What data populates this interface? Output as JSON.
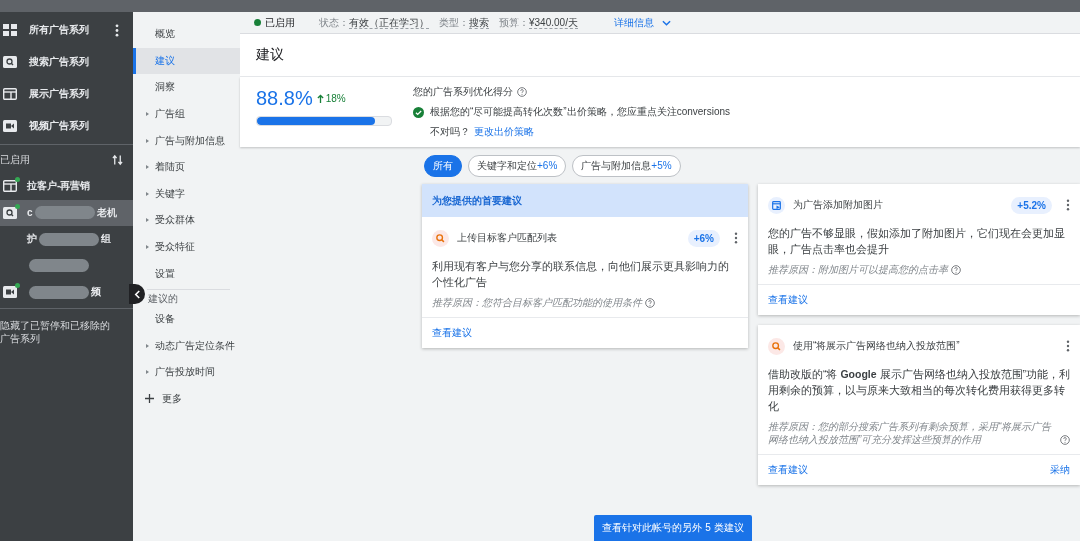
{
  "sidebar": {
    "header": {
      "label": "所有广告系列"
    },
    "types": [
      {
        "label": "搜索广告系列",
        "kind": "search"
      },
      {
        "label": "展示广告系列",
        "kind": "display"
      },
      {
        "label": "视频广告系列",
        "kind": "video"
      }
    ],
    "enabled_label": "已启用",
    "campaigns": [
      {
        "kind": "display",
        "prefix": "拉客户-再营销",
        "enabled": true,
        "selected": false
      },
      {
        "kind": "search",
        "prefix": "c",
        "suffix": "老机",
        "redacted": true,
        "enabled": true,
        "selected": true
      },
      {
        "kind": "adgroup",
        "prefix": "护",
        "suffix": "组",
        "redacted": true,
        "selected": false
      },
      {
        "kind": "adgroup",
        "redacted": true,
        "selected": false
      },
      {
        "kind": "video",
        "suffix": "频",
        "redacted": true,
        "enabled": true,
        "selected": false
      }
    ],
    "footer": "隐藏了已暂停和已移除的广告系列"
  },
  "nav": {
    "items": [
      {
        "label": "概览",
        "expandable": false,
        "selected": false
      },
      {
        "label": "建议",
        "expandable": false,
        "selected": true
      },
      {
        "label": "洞察",
        "expandable": false,
        "selected": false
      },
      {
        "label": "广告组",
        "expandable": true,
        "selected": false
      },
      {
        "label": "广告与附加信息",
        "expandable": true,
        "selected": false
      },
      {
        "label": "着陆页",
        "expandable": true,
        "selected": false
      },
      {
        "label": "关键字",
        "expandable": true,
        "selected": false
      },
      {
        "label": "受众群体",
        "expandable": true,
        "selected": false
      },
      {
        "label": "受众特征",
        "expandable": true,
        "selected": false
      },
      {
        "label": "设置",
        "expandable": false,
        "selected": false
      }
    ],
    "section_label": "建议的",
    "more_items": [
      {
        "label": "设备",
        "expandable": false,
        "selected": false
      },
      {
        "label": "动态广告定位条件",
        "expandable": true,
        "selected": false
      },
      {
        "label": "广告投放时间",
        "expandable": true,
        "selected": false
      }
    ],
    "more": "更多"
  },
  "status_bar": {
    "status": "已启用",
    "fields": [
      {
        "label": "状态：",
        "value": "有效（正在学习）"
      },
      {
        "label": "类型：",
        "value": "搜索"
      },
      {
        "label": "预算：",
        "value": "¥340.00/天"
      }
    ],
    "details": "详细信息"
  },
  "page_title": "建议",
  "score": {
    "value": "88.8%",
    "change": "18%",
    "level": 0.88,
    "title": "您的广告系列优化得分",
    "message": "根据您的“尽可能提高转化次数”出价策略，您应重点关注conversions",
    "question": "不对吗？",
    "link": "更改出价策略"
  },
  "chips": [
    {
      "label": "所有",
      "selected": true
    },
    {
      "label": "关键字和定位",
      "uplift": "+6%",
      "selected": false
    },
    {
      "label": "广告与附加信息",
      "uplift": "+5%",
      "selected": false
    }
  ],
  "columns": [
    {
      "header": "为您提供的首要建议",
      "cards": [
        {
          "kind": "search",
          "title": "上传目标客户匹配列表",
          "uplift": "+6%",
          "body": "利用现有客户与您分享的联系信息，向他们展示更具影响力的个性化广告",
          "reason": "推荐原因：您符合目标客户匹配功能的使用条件",
          "view": "查看建议"
        }
      ]
    },
    {
      "cards": [
        {
          "kind": "image",
          "title": "为广告添加附加图片",
          "uplift": "+5.2%",
          "body": "您的广告不够显眼，假如添加了附加图片，它们现在会更加显眼，广告点击率也会提升",
          "reason": "推荐原因：附加图片可以提高您的点击率",
          "view": "查看建议"
        },
        {
          "kind": "search",
          "title": "使用“将展示广告网络也纳入投放范围”",
          "body": "借助改版的“将 **Google** 展示广告网络也纳入投放范围”功能，利用剩余的预算，以与原来大致相当的每次转化费用获得更多转化",
          "reason": "推荐原因：您的部分搜索广告系列有剩余预算，采用“将展示广告网络也纳入投放范围”可充分发挥这些预算的作用",
          "view": "查看建议",
          "apply": "采纳"
        }
      ]
    }
  ],
  "footer_button": "查看针对此帐号的另外 5 类建议"
}
